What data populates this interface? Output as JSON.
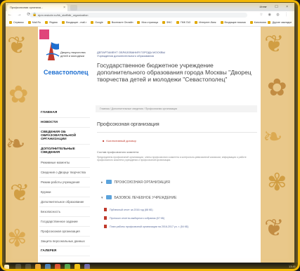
{
  "browser": {
    "tab_title": "Профсоюзная организа...",
    "tab_close": "×",
    "window_user": "Инна",
    "window_controls": "— ☐ ×",
    "nav_glyphs": "← → ⟳",
    "url": "dpm.mskobr.ru/trk_staff/dtr_organization",
    "extensions": "☆ ◉ ◍ ⋮",
    "bookmarks": [
      "Сервисы",
      "Mail.Ru",
      "Яндекс",
      "Входящие - mail.r",
      "Google",
      "Вконтакте Онлайн",
      "Моя страница",
      "ФНС",
      "ГМК ГАЗ",
      "Интернет-банк",
      "Входящие письма",
      "Кинопоиск"
    ],
    "bookmarks_right": "Другие закладки"
  },
  "logo": {
    "tagline": "Дворец творчества детей и молодежи",
    "name": "Севастополец"
  },
  "sidebar": {
    "items": [
      {
        "label": "ГЛАВНАЯ",
        "bold": true
      },
      {
        "label": "НОВОСТИ",
        "bold": true
      },
      {
        "label": "СВЕДЕНИЯ ОБ ОБРАЗОВАТЕЛЬНОЙ ОРГАНИЗАЦИИ",
        "bold": true
      },
      {
        "label": "ДОПОЛНИТЕЛЬНЫЕ СВЕДЕНИЯ",
        "bold": true
      },
      {
        "label": "Режимные моменты",
        "bold": false
      },
      {
        "label": "Сведения о Дворце творчества",
        "bold": false
      },
      {
        "label": "Режим работы учреждения",
        "bold": false
      },
      {
        "label": "Кружки",
        "bold": false
      },
      {
        "label": "Дополнительное образование",
        "bold": false
      },
      {
        "label": "Безопасность",
        "bold": false
      },
      {
        "label": "Государственное задание",
        "bold": false
      },
      {
        "label": "Профсоюзная организация",
        "bold": false
      },
      {
        "label": "Защита персональных данных",
        "bold": false
      },
      {
        "label": "ГАЛЕРЕЯ",
        "bold": true
      }
    ]
  },
  "main": {
    "dept": "ДЕПАРТАМЕНТ ОБРАЗОВАНИЯ ГОРОДА МОСКВЫ",
    "dept_sub": "Учреждения дополнительного образования",
    "title": "Государственное бюджетное учреждение дополнительного образования города Москвы \"Дворец творчества детей и молодежи \"Севастополец\"",
    "breadcrumb": "Главная / Дополнительные сведения / Профсоюзная организация",
    "heading": "Профсоюзная организация",
    "doc_link": "Коллективный договор",
    "composition": "Состав профсоюзного комитета",
    "paragraph": "Председатель профсоюзной организации, члены профсоюзного комитета и контрольно-ревизионной комиссии; информация о работе профсоюзного комитета учреждения и профсоюзной организации.",
    "folders": [
      {
        "label": "ПРОФСОЮЗНАЯ ОРГАНИЗАЦИЯ"
      },
      {
        "label": "БАЗОВОЕ ЛЕЧЕБНОЕ УЧРЕЖДЕНИЕ"
      }
    ],
    "files": [
      {
        "label": "Публичный отчет за 2016 год (88 КБ)"
      },
      {
        "label": "Протокол отчетно-выборного собрания (67 КБ)"
      },
      {
        "label": "План работы профсоюзной организации на 2016-2017 уч. г. (54 КБ)"
      }
    ]
  },
  "taskbar": {
    "tray_time": "13:41"
  },
  "colors": {
    "frame_glow": "#f2b705",
    "logo_blue": "#1e6fd0",
    "logo_pink": "#e0457b",
    "folder_blue": "#5ba3dc"
  }
}
